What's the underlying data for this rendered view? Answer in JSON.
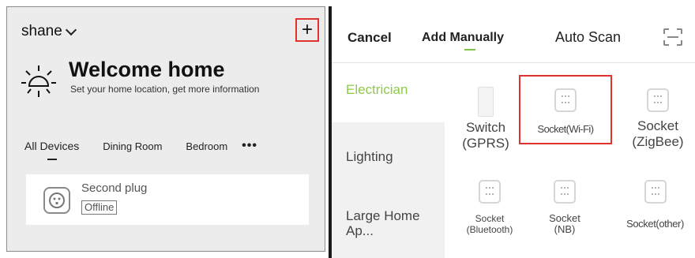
{
  "left_panel": {
    "home_name": "shane",
    "add_icon": "plus-icon",
    "welcome_title": "Welcome home",
    "welcome_subtitle": "Set your home location, get more information",
    "room_tabs": [
      "All Devices",
      "Dining Room",
      "Bedroom"
    ],
    "more_icon_text": "•••",
    "device": {
      "name": "Second plug",
      "status": "Offline",
      "icon": "plug-icon"
    }
  },
  "right_panel": {
    "cancel_label": "Cancel",
    "tab_manual": "Add Manually",
    "tab_auto": "Auto Scan",
    "scan_icon": "scan-icon",
    "categories": [
      "Electrician",
      "Lighting",
      "Large Home Ap..."
    ],
    "active_category": "Electrician",
    "devices": [
      {
        "label": "Switch (GPRS)",
        "icon": "switch-icon"
      },
      {
        "label": "Socket(Wi-Fi)",
        "icon": "socket-icon"
      },
      {
        "label": "Socket (ZigBee)",
        "icon": "socket-icon"
      },
      {
        "label": "Socket (Bluetooth)",
        "icon": "socket-icon"
      },
      {
        "label": "Socket (NB)",
        "icon": "socket-icon"
      },
      {
        "label": "Socket(other)",
        "icon": "socket-icon"
      }
    ]
  },
  "colors": {
    "accent_green": "#8fc94a",
    "highlight_red": "#e0332f"
  }
}
